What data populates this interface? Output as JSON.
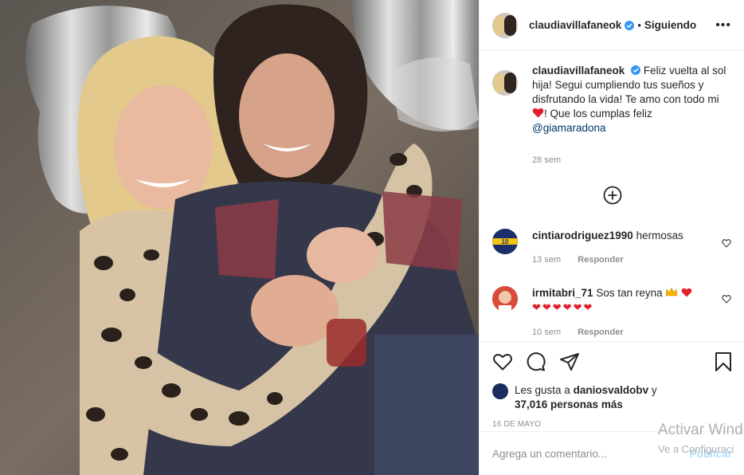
{
  "post": {
    "photo_alt": "",
    "author": "claudiavillafaneok",
    "verified": true,
    "separator": "•",
    "follow_state": "Siguiendo",
    "more_icon": "more-options-icon"
  },
  "caption": {
    "username": "claudiavillafaneok",
    "text": "Feliz vuelta al sol hija! Segui cumpliendo tus sueños y disfrutando la vida! Te amo con todo mi",
    "text_after_heart": "! Que los cumplas feliz",
    "mention": "@giamaradona",
    "time": "28 sem"
  },
  "load_more_icon": "plus-circle-icon",
  "comments": [
    {
      "username": "cintiarodriguez1990",
      "text": "hermosas",
      "time": "13 sem",
      "reply": "Responder"
    },
    {
      "username": "irmitabri_71",
      "text": "Sos tan reyna",
      "hearts": "❤❤❤❤❤❤",
      "time": "10 sem",
      "reply": "Responder"
    }
  ],
  "likes": {
    "prefix": "Les gusta a",
    "user": "daniosvaldobv",
    "connector": "y",
    "count": "37,016 personas más"
  },
  "date": "16 DE MAYO",
  "add_comment": {
    "placeholder": "Agrega un comentario...",
    "publish": "Publicar"
  },
  "os_watermark": {
    "line1": "Activar Wind",
    "line2": "Ve a Configuraci"
  },
  "colors": {
    "verified": "#3897f0",
    "heart": "#ed4956",
    "link": "#00376b",
    "publish": "#b2dffc"
  }
}
